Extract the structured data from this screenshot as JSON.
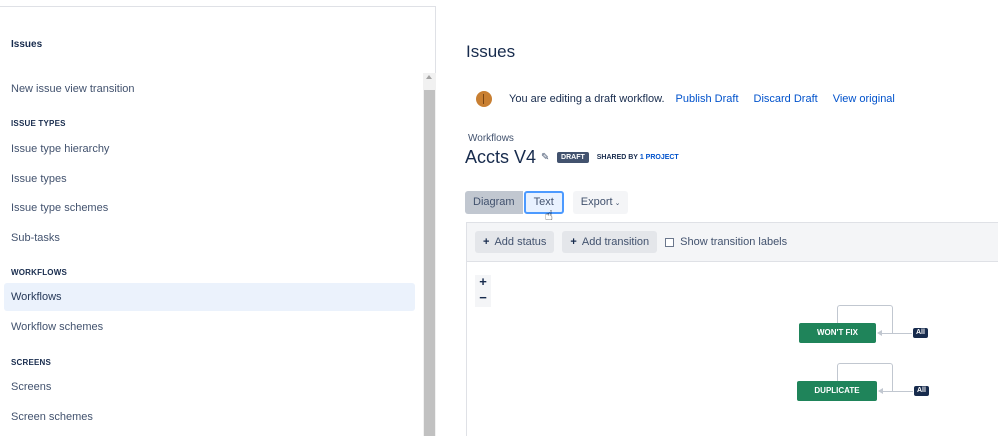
{
  "sidebar": {
    "title": "Issues",
    "items": [
      {
        "label": "New issue view transition"
      },
      {
        "label": "Issue type hierarchy"
      },
      {
        "label": "Issue types"
      },
      {
        "label": "Issue type schemes"
      },
      {
        "label": "Sub-tasks"
      },
      {
        "label": "Workflows",
        "active": true
      },
      {
        "label": "Workflow schemes"
      },
      {
        "label": "Screens"
      },
      {
        "label": "Screen schemes"
      }
    ],
    "sections": {
      "issue_types": "ISSUE TYPES",
      "workflows": "WORKFLOWS",
      "screens": "SCREENS"
    }
  },
  "main": {
    "title": "Issues",
    "draft_notice": {
      "text": "You are editing a draft workflow.",
      "publish": "Publish Draft",
      "discard": "Discard Draft",
      "view_original": "View original"
    },
    "workflow": {
      "label": "Workflows",
      "name": "Accts V4",
      "lozenge": "DRAFT",
      "shared_prefix": "SHARED BY",
      "shared_project": "1 PROJECT"
    },
    "view_tabs": {
      "diagram": "Diagram",
      "text": "Text",
      "export": "Export"
    },
    "toolbar": {
      "add_status": "Add status",
      "add_transition": "Add transition",
      "show_labels": "Show transition labels"
    },
    "zoom": {
      "in": "+",
      "out": "−"
    },
    "statuses": [
      {
        "label": "WON'T FIX",
        "tag": "All"
      },
      {
        "label": "DUPLICATE",
        "tag": "All"
      }
    ]
  },
  "colors": {
    "accent": "#0052cc",
    "status_done": "#1f845a",
    "active_nav": "#ebf2fc"
  }
}
